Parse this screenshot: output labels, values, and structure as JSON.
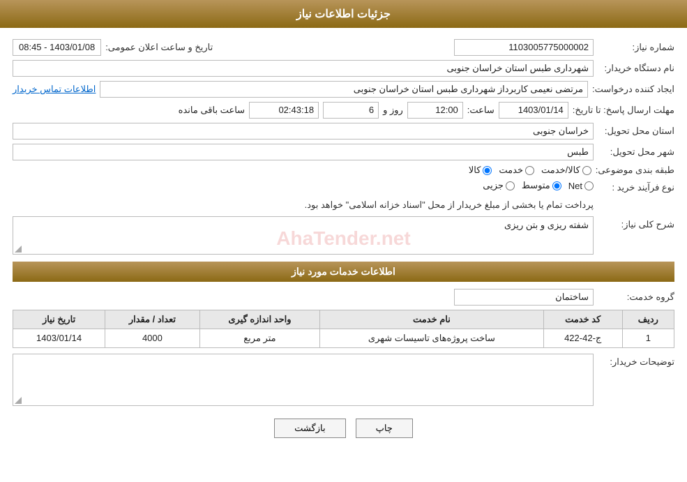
{
  "header": {
    "title": "جزئیات اطلاعات نیاز"
  },
  "fields": {
    "need_number_label": "شماره نیاز:",
    "need_number_value": "1103005775000002",
    "buyer_org_label": "نام دستگاه خریدار:",
    "buyer_org_value": "شهرداری طبس استان خراسان جنوبی",
    "announce_label": "تاریخ و ساعت اعلان عمومی:",
    "announce_value": "1403/01/08 - 08:45",
    "creator_label": "ایجاد کننده درخواست:",
    "creator_value": "مرتضی نعیمی کاربرداز شهرداری طبس استان خراسان جنوبی",
    "contact_link": "اطلاعات تماس خریدار",
    "deadline_label": "مهلت ارسال پاسخ: تا تاریخ:",
    "deadline_date": "1403/01/14",
    "deadline_time_label": "ساعت:",
    "deadline_time": "12:00",
    "deadline_day_label": "روز و",
    "deadline_days": "6",
    "deadline_remain_label": "ساعت باقی مانده",
    "deadline_remain": "02:43:18",
    "province_label": "استان محل تحویل:",
    "province_value": "خراسان جنوبی",
    "city_label": "شهر محل تحویل:",
    "city_value": "طبس",
    "category_label": "طبقه بندی موضوعی:",
    "category_options": [
      "کالا",
      "خدمت",
      "کالا/خدمت"
    ],
    "category_selected": "کالا",
    "process_label": "نوع فرآیند خرید :",
    "process_options": [
      "جزیی",
      "متوسط",
      "Net"
    ],
    "process_selected": "متوسط",
    "process_text": "پرداخت تمام یا بخشی از مبلغ خریدار از محل \"اسناد خزانه اسلامی\" خواهد بود.",
    "sharh_label": "شرح کلی نیاز:",
    "sharh_value": "شفته ریزی و بتن ریزی",
    "services_section": "اطلاعات خدمات مورد نیاز",
    "group_label": "گروه خدمت:",
    "group_value": "ساختمان",
    "table_headers": [
      "ردیف",
      "کد خدمت",
      "نام خدمت",
      "واحد اندازه گیری",
      "تعداد / مقدار",
      "تاریخ نیاز"
    ],
    "table_rows": [
      {
        "row": "1",
        "code": "ج-42-422",
        "name": "ساخت پروژه‌های تاسیسات شهری",
        "unit": "متر مربع",
        "quantity": "4000",
        "date": "1403/01/14"
      }
    ],
    "buyer_desc_label": "توضیحات خریدار:",
    "buyer_desc_value": ""
  },
  "buttons": {
    "print": "چاپ",
    "back": "بازگشت"
  },
  "watermark": "AhaTender.net"
}
